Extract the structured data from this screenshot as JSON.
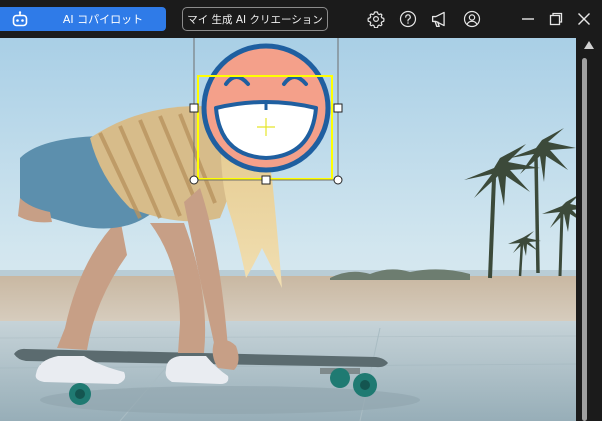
{
  "header": {
    "ai_copilot_label": "AI コパイロット",
    "creation_label": "マイ 生成 AI クリエーション"
  },
  "icons": {
    "robot": "robot-icon",
    "settings": "gear-icon",
    "help": "help-icon",
    "announce": "megaphone-icon",
    "account": "user-icon",
    "minimize": "minimize-icon",
    "restore": "restore-icon",
    "close": "close-icon"
  },
  "colors": {
    "accent": "#2f7be8",
    "selection": "#ffff00",
    "emoji_face": "#f4a08a",
    "emoji_outline": "#1f5fa0"
  }
}
